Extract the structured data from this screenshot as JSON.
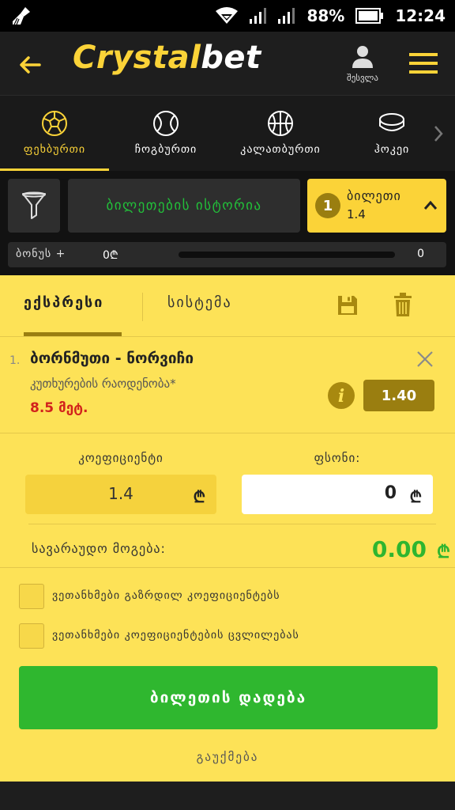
{
  "status_bar": {
    "battery": "88%",
    "time": "12:24"
  },
  "header": {
    "logo_main": "Crystal",
    "logo_accent": "bet",
    "user_label": "შესვლა"
  },
  "sports": [
    {
      "label": "ფეხბურთი",
      "icon": "soccer-ball-icon",
      "active": true
    },
    {
      "label": "ჩოგბურთი",
      "icon": "tennis-ball-icon",
      "active": false
    },
    {
      "label": "კალათბურთი",
      "icon": "basketball-icon",
      "active": false
    },
    {
      "label": "ჰოკეი",
      "icon": "hockey-puck-icon",
      "active": false
    }
  ],
  "toolbar": {
    "history_label": "ბილეთების ისტორია"
  },
  "ticket": {
    "count": "1",
    "label": "ბილეთი",
    "odds": "1.4"
  },
  "bonus": {
    "label": "ბონუს +",
    "amount": "0₾",
    "value": "0",
    "progress": 0
  },
  "betslip": {
    "tabs": [
      "ექსპრესი",
      "სისტემა"
    ],
    "active_tab": 0,
    "item": {
      "index": "1.",
      "match": "ბორნმუთი - ნორვიჩი",
      "market": "კუთხურების რაოდენობა*",
      "selection": "8.5 მეტ.",
      "odds": "1.40"
    },
    "coef_label": "კოეფიციენტი",
    "coef_value": "1.4",
    "stake_label": "ფსონი:",
    "stake_value": "0",
    "currency": "₾",
    "payout_label": "სავარაუდო მოგება:",
    "payout_value": "0.00",
    "checkboxes": [
      {
        "label": "ვეთანხმები გაზრდილ კოეფიციენტებს",
        "checked": false
      },
      {
        "label": "ვეთანხმები კოეფიციენტების ცვლილებას",
        "checked": false
      }
    ],
    "place_button": "ბილეთის დადება",
    "cancel_link": "გაუქმება"
  },
  "colors": {
    "brand_yellow": "#fbd338",
    "panel_yellow": "#fde257",
    "green": "#2fb72f",
    "red": "#d2221c",
    "dark": "#1e1e1e"
  }
}
